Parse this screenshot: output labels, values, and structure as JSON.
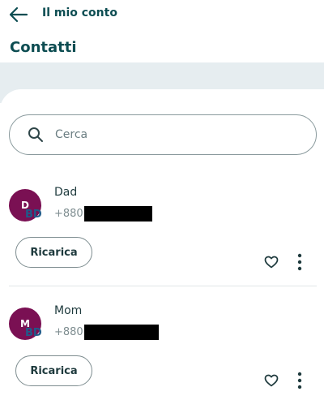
{
  "header": {
    "title": "Il mio conto",
    "page_title": "Contatti"
  },
  "search": {
    "placeholder": "Cerca",
    "value": ""
  },
  "contacts": [
    {
      "initial": "D",
      "country_code": "BD",
      "name": "Dad",
      "phone_prefix": "+880",
      "action_label": "Ricarica"
    },
    {
      "initial": "M",
      "country_code": "BD",
      "name": "Mom",
      "phone_prefix": "+880",
      "action_label": "Ricarica"
    }
  ],
  "icons": {
    "back": "arrow-left-icon",
    "search": "search-icon",
    "favorite": "heart-outline-icon",
    "more": "more-vertical-icon"
  },
  "colors": {
    "brand_teal": "#0d4d52",
    "avatar_plum": "#7a1053",
    "band_grey": "#e6edf0"
  }
}
